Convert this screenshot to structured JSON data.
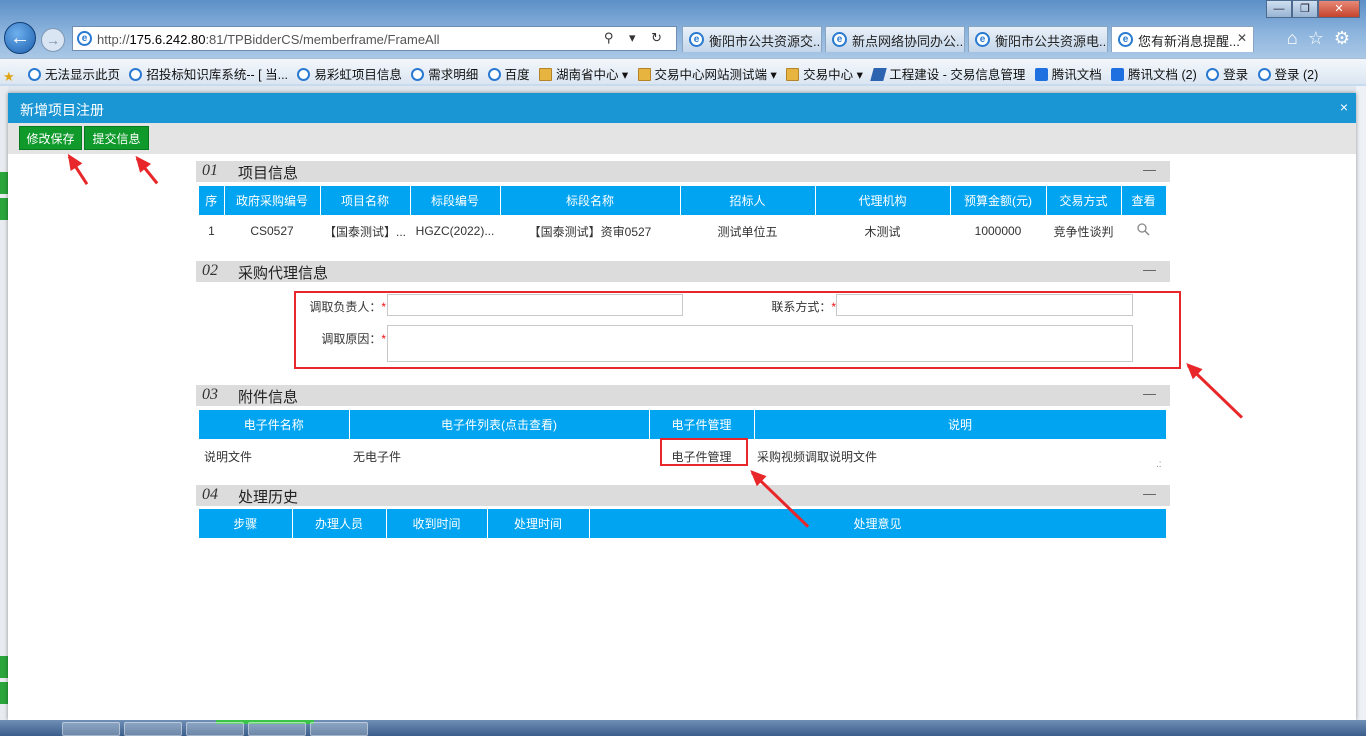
{
  "browser": {
    "url_prefix": "http://",
    "url_host": "175.6.242.80",
    "url_rest": ":81/TPBidderCS/memberframe/FrameAll",
    "addr_tools": "⚲ ▾ ↻",
    "tabs": [
      {
        "label": "衡阳市公共资源交..."
      },
      {
        "label": "新点网络协同办公..."
      },
      {
        "label": "衡阳市公共资源电..."
      },
      {
        "label": "您有新消息提醒..."
      }
    ],
    "favorites": [
      {
        "label": "无法显示此页",
        "icon": "ie"
      },
      {
        "label": "招投标知识库系统-- [ 当...",
        "icon": "ie"
      },
      {
        "label": "易彩虹项目信息",
        "icon": "ie"
      },
      {
        "label": "需求明细",
        "icon": "ie"
      },
      {
        "label": "百度",
        "icon": "ie"
      },
      {
        "label": "湖南省中心 ▾",
        "icon": "folder"
      },
      {
        "label": "交易中心网站测试端 ▾",
        "icon": "folder"
      },
      {
        "label": "交易中心 ▾",
        "icon": "folder"
      },
      {
        "label": "工程建设 - 交易信息管理",
        "icon": "gov"
      },
      {
        "label": "腾讯文档",
        "icon": "tencent"
      },
      {
        "label": "腾讯文档 (2)",
        "icon": "tencent"
      },
      {
        "label": "登录",
        "icon": "ie"
      },
      {
        "label": "登录 (2)",
        "icon": "ie"
      }
    ]
  },
  "dialog": {
    "title": "新增项目注册",
    "close": "×",
    "toolbar": {
      "save_label": "修改保存",
      "submit_label": "提交信息"
    }
  },
  "section1": {
    "num": "01",
    "title": "项目信息",
    "collapse": "—",
    "headers": [
      "序",
      "政府采购编号",
      "项目名称",
      "标段编号",
      "标段名称",
      "招标人",
      "代理机构",
      "预算金额(元)",
      "交易方式",
      "查看"
    ],
    "rows": [
      [
        "1",
        "CS0527",
        "【国泰测试】...",
        "HGZC(2022)...",
        "【国泰测试】资审0527",
        "测试单位五",
        "木测试",
        "1000000",
        "竞争性谈判"
      ]
    ]
  },
  "section2": {
    "num": "02",
    "title": "采购代理信息",
    "collapse": "—",
    "fields": {
      "requester_label": "调取负责人：",
      "contact_label": "联系方式：",
      "reason_label": "调取原因：",
      "required_mark": "*",
      "requester_value": "",
      "contact_value": "",
      "reason_value": ""
    }
  },
  "section3": {
    "num": "03",
    "title": "附件信息",
    "collapse": "—",
    "headers": [
      "电子件名称",
      "电子件列表(点击查看)",
      "电子件管理",
      "说明"
    ],
    "rows": [
      {
        "name": "说明文件",
        "list": "无电子件",
        "manage": "电子件管理",
        "desc": "采购视频调取说明文件"
      }
    ]
  },
  "section4": {
    "num": "04",
    "title": "处理历史",
    "collapse": "—",
    "headers": [
      "步骤",
      "办理人员",
      "收到时间",
      "处理时间",
      "处理意见"
    ]
  },
  "colors": {
    "accent": "#1b96d4",
    "table_header": "#00a4f1",
    "button": "#0f9a2b",
    "annotation": "#e8272a"
  }
}
